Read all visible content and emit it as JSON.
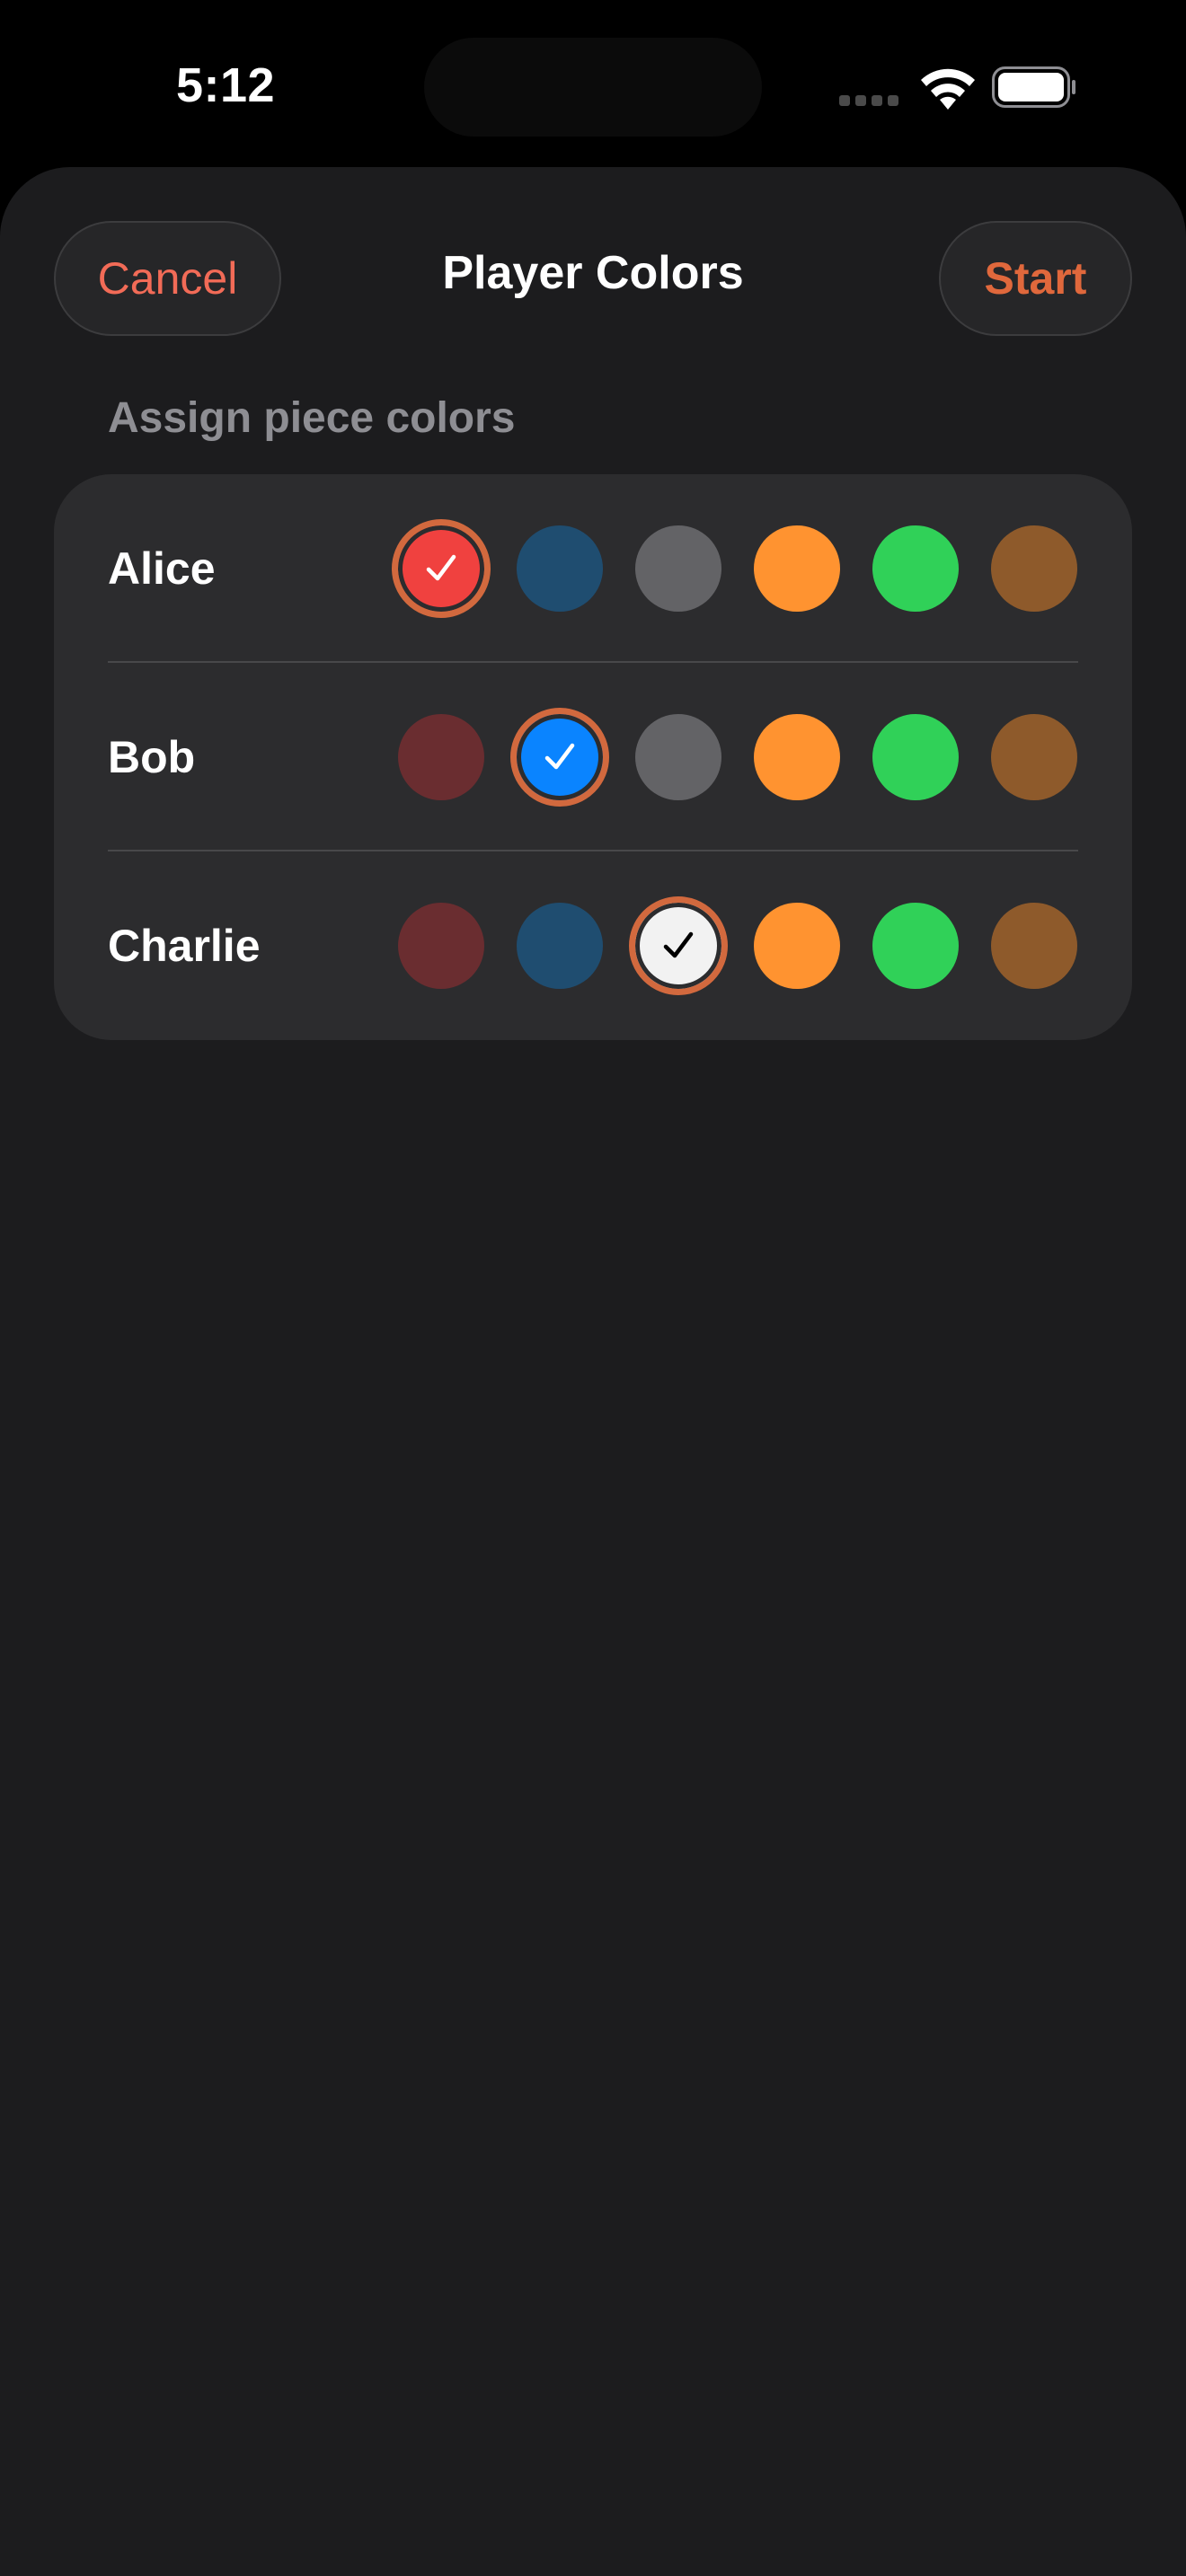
{
  "status_bar": {
    "time": "5:12",
    "signal_icon": "cellular-signal-icon",
    "wifi_icon": "wifi-icon",
    "battery_icon": "battery-icon"
  },
  "sheet": {
    "title": "Player Colors",
    "cancel_label": "Cancel",
    "start_label": "Start",
    "section_header": "Assign piece colors"
  },
  "colors": {
    "background": "#000000",
    "sheet_background": "#1c1c1e",
    "card_background": "#2c2c2e",
    "accent": "#d2693e",
    "cancel_text": "#f26b57",
    "start_text": "#e0683c"
  },
  "players": [
    {
      "name": "Alice",
      "selected_index": 0,
      "swatches": [
        "#f0413f",
        "#1f4d70",
        "#636366",
        "#ff9330",
        "#30d158",
        "#8e5a2b"
      ]
    },
    {
      "name": "Bob",
      "selected_index": 1,
      "swatches": [
        "#6a2d30",
        "#0a84ff",
        "#636366",
        "#ff9330",
        "#30d158",
        "#8e5a2b"
      ]
    },
    {
      "name": "Charlie",
      "selected_index": 2,
      "swatches": [
        "#6a2d30",
        "#1f4d70",
        "#f2f2f2",
        "#ff9330",
        "#30d158",
        "#8e5a2b"
      ]
    }
  ]
}
